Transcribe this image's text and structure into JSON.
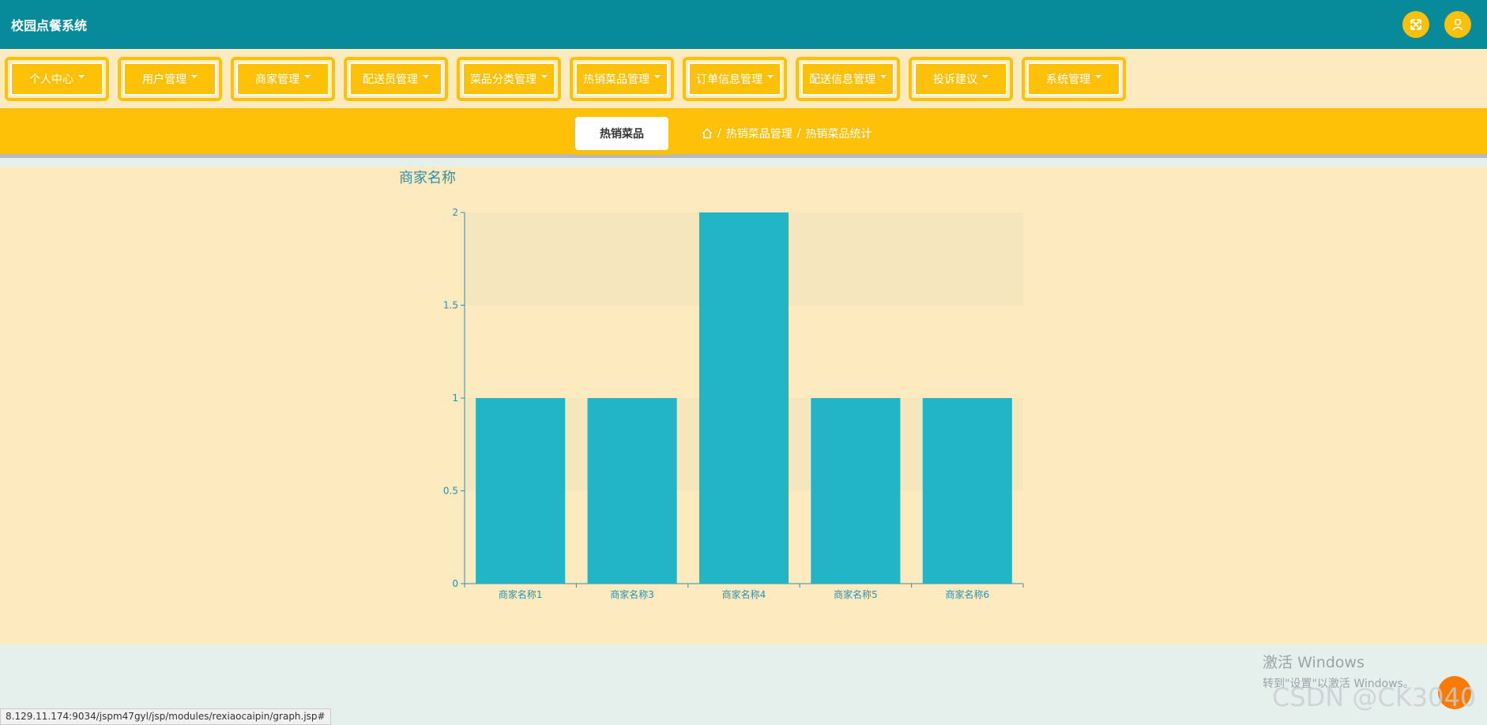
{
  "app": {
    "title": "校园点餐系统"
  },
  "header": {
    "fullscreen_icon": "expand-arrows-icon",
    "user_icon": "user-icon",
    "accent": "#ffc107",
    "bar_color": "#078b9b"
  },
  "nav": {
    "items": [
      {
        "label": "个人中心"
      },
      {
        "label": "用户管理"
      },
      {
        "label": "商家管理"
      },
      {
        "label": "配送员管理"
      },
      {
        "label": "菜品分类管理"
      },
      {
        "label": "热销菜品管理"
      },
      {
        "label": "订单信息管理"
      },
      {
        "label": "配送信息管理"
      },
      {
        "label": "投诉建议"
      },
      {
        "label": "系统管理"
      }
    ]
  },
  "subbar": {
    "tab_label": "热销菜品",
    "breadcrumb": [
      "热销菜品管理",
      "热销菜品统计"
    ],
    "separator": "/"
  },
  "chart_data": {
    "type": "bar",
    "title": "商家名称",
    "categories": [
      "商家名称1",
      "商家名称3",
      "商家名称4",
      "商家名称5",
      "商家名称6"
    ],
    "values": [
      1,
      1,
      2,
      1,
      1
    ],
    "ylim": [
      0,
      2
    ],
    "yticks": [
      "0",
      "0.5",
      "1",
      "1.5",
      "2"
    ],
    "grid": "alternating bands",
    "bar_color": "#22b5c8"
  },
  "watermarks": {
    "windows_line1": "激活 Windows",
    "windows_line2": "转到\"设置\"以激活 Windows。",
    "csdn": "CSDN @CK3040"
  },
  "statusbar": {
    "url": "8.129.11.174:9034/jspm47gyl/jsp/modules/rexiaocaipin/graph.jsp#"
  }
}
